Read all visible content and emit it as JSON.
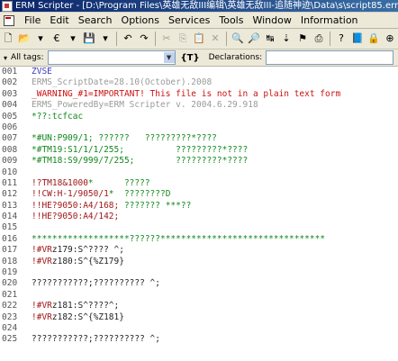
{
  "window": {
    "title": "ERM Scripter - [D:\\Program Files\\英雄无敌III编辑\\英雄无敌III-追随神迹\\Data\\s\\script85.erm]"
  },
  "menu": {
    "items": [
      "File",
      "Edit",
      "Search",
      "Options",
      "Services",
      "Tools",
      "Window",
      "Information"
    ]
  },
  "toolbar": {
    "buttons": [
      {
        "name": "new-file-icon",
        "glyph": "🗋",
        "enabled": true
      },
      {
        "name": "open-folder-icon",
        "glyph": "📂",
        "enabled": true
      },
      {
        "name": "dropdown-arrow-icon",
        "glyph": "▾",
        "enabled": true
      },
      {
        "name": "reopen-icon",
        "glyph": "€",
        "enabled": true
      },
      {
        "name": "dropdown-arrow-icon",
        "glyph": "▾",
        "enabled": true
      },
      {
        "name": "save-icon",
        "glyph": "💾",
        "enabled": true
      },
      {
        "name": "dropdown-arrow-icon",
        "glyph": "▾",
        "enabled": true
      },
      {
        "name": "undo-icon",
        "glyph": "↶",
        "enabled": true
      },
      {
        "name": "redo-icon",
        "glyph": "↷",
        "enabled": true
      },
      {
        "name": "cut-icon",
        "glyph": "✂",
        "enabled": false
      },
      {
        "name": "copy-icon",
        "glyph": "⎘",
        "enabled": false
      },
      {
        "name": "paste-icon",
        "glyph": "📋",
        "enabled": false
      },
      {
        "name": "delete-icon",
        "glyph": "✕",
        "enabled": false
      },
      {
        "name": "find-icon",
        "glyph": "🔍",
        "enabled": true
      },
      {
        "name": "find-next-icon",
        "glyph": "🔎",
        "enabled": true
      },
      {
        "name": "replace-icon",
        "glyph": "↹",
        "enabled": true
      },
      {
        "name": "goto-line-icon",
        "glyph": "⇣",
        "enabled": true
      },
      {
        "name": "bookmark-icon",
        "glyph": "⚑",
        "enabled": true
      },
      {
        "name": "print-icon",
        "glyph": "⎙",
        "enabled": true
      },
      {
        "name": "script-check-icon",
        "glyph": "?",
        "enabled": true
      },
      {
        "name": "help-book-icon",
        "glyph": "📘",
        "enabled": true
      },
      {
        "name": "lock-icon",
        "glyph": "🔒",
        "enabled": true
      },
      {
        "name": "pin-icon",
        "glyph": "⊕",
        "enabled": true
      }
    ]
  },
  "tags_bar": {
    "all_tags_label": "All tags:",
    "all_tags_value": "",
    "curly_label": "{T}",
    "declarations_label": "Declarations:",
    "declarations_value": ""
  },
  "editor": {
    "lines": [
      {
        "n": "001",
        "segments": [
          {
            "t": "ZVSE",
            "c": "blue"
          }
        ]
      },
      {
        "n": "002",
        "segments": [
          {
            "t": "ERMS_ScriptDate=28.10(October).2008",
            "c": "gray"
          }
        ]
      },
      {
        "n": "003",
        "segments": [
          {
            "t": "_WARNING_#1=IMPORTANT! This file is not in a plain text form",
            "c": "red"
          }
        ]
      },
      {
        "n": "004",
        "segments": [
          {
            "t": "ERMS_PoweredBy=ERM Scripter v. 2004.6.29.918",
            "c": "gray"
          }
        ]
      },
      {
        "n": "005",
        "segments": [
          {
            "t": "*??:tcfcac",
            "c": "green"
          }
        ]
      },
      {
        "n": "006",
        "segments": []
      },
      {
        "n": "007",
        "segments": [
          {
            "t": "*#UN:P909/1; ??????   ?????????*????",
            "c": "green"
          }
        ]
      },
      {
        "n": "008",
        "segments": [
          {
            "t": "*#TM19:S1/1/1/255;          ?????????*????",
            "c": "green"
          }
        ]
      },
      {
        "n": "009",
        "segments": [
          {
            "t": "*#TM18:S9/999/7/255;        ?????????*????",
            "c": "green"
          }
        ]
      },
      {
        "n": "010",
        "segments": []
      },
      {
        "n": "011",
        "segments": [
          {
            "t": "!?TM18&1000",
            "c": "darkred"
          },
          {
            "t": "*      ?????",
            "c": "green"
          }
        ]
      },
      {
        "n": "012",
        "segments": [
          {
            "t": "!!CW:H-1/9050/1",
            "c": "darkred"
          },
          {
            "t": "*  ????????D",
            "c": "green"
          }
        ]
      },
      {
        "n": "013",
        "segments": [
          {
            "t": "!!HE?9050:A4/168;",
            "c": "darkred"
          },
          {
            "t": " ??????? ***??",
            "c": "green"
          }
        ]
      },
      {
        "n": "014",
        "segments": [
          {
            "t": "!!HE?9050:A4/142;",
            "c": "darkred"
          }
        ]
      },
      {
        "n": "015",
        "segments": []
      },
      {
        "n": "016",
        "segments": [
          {
            "t": "*******************??????********************************",
            "c": "green"
          }
        ]
      },
      {
        "n": "017",
        "segments": [
          {
            "t": "!#VR",
            "c": "darkred"
          },
          {
            "t": "z179:S^???? ^;",
            "c": "black"
          }
        ]
      },
      {
        "n": "018",
        "segments": [
          {
            "t": "!#VR",
            "c": "darkred"
          },
          {
            "t": "z180:S^{%Z179}",
            "c": "black"
          }
        ]
      },
      {
        "n": "019",
        "segments": []
      },
      {
        "n": "020",
        "segments": [
          {
            "t": "???????????;?????????? ^;",
            "c": "black"
          }
        ]
      },
      {
        "n": "021",
        "segments": []
      },
      {
        "n": "022",
        "segments": [
          {
            "t": "!#VR",
            "c": "darkred"
          },
          {
            "t": "z181:S^????^;",
            "c": "black"
          }
        ]
      },
      {
        "n": "023",
        "segments": [
          {
            "t": "!#VR",
            "c": "darkred"
          },
          {
            "t": "z182:S^{%Z181}",
            "c": "black"
          }
        ]
      },
      {
        "n": "024",
        "segments": []
      },
      {
        "n": "025",
        "segments": [
          {
            "t": "???????????;?????????? ^;",
            "c": "black"
          }
        ]
      }
    ]
  }
}
